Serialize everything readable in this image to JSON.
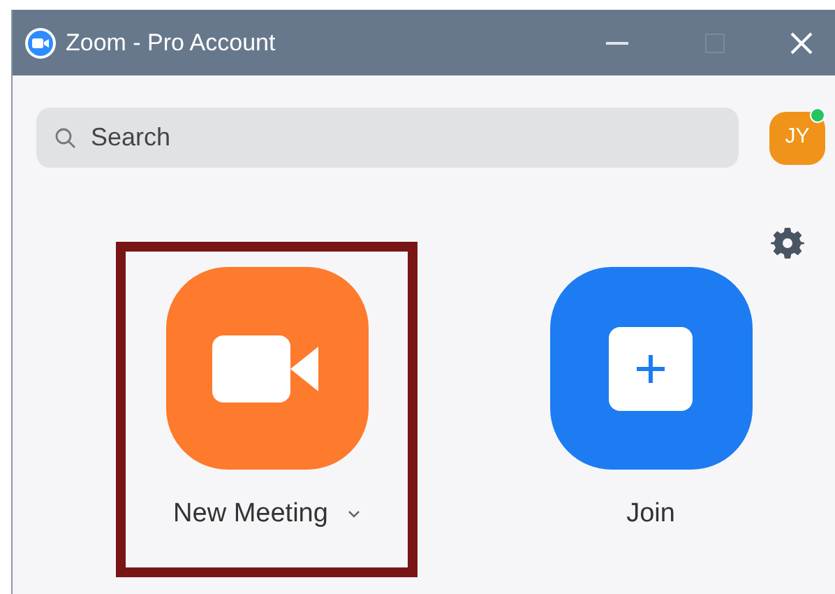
{
  "window": {
    "title": "Zoom - Pro Account"
  },
  "search": {
    "placeholder": "Search"
  },
  "avatar": {
    "initials": "JY",
    "online": true
  },
  "actions": [
    {
      "kind": "new_meeting",
      "label": "New Meeting",
      "has_menu": true,
      "highlighted": true
    },
    {
      "kind": "join",
      "label": "Join",
      "has_menu": false,
      "highlighted": false
    }
  ]
}
